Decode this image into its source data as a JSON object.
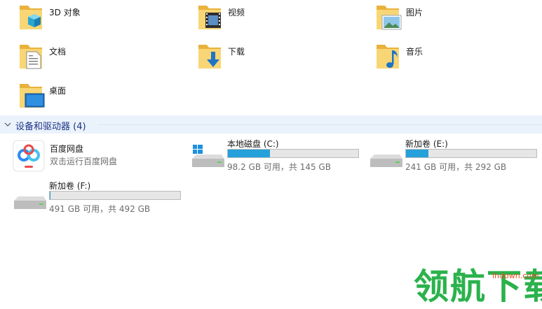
{
  "folders": [
    {
      "label": "3D 对象",
      "icon": "3d-objects-icon"
    },
    {
      "label": "视频",
      "icon": "videos-icon"
    },
    {
      "label": "图片",
      "icon": "pictures-icon"
    },
    {
      "label": "文档",
      "icon": "documents-icon"
    },
    {
      "label": "下载",
      "icon": "downloads-icon"
    },
    {
      "label": "音乐",
      "icon": "music-icon"
    },
    {
      "label": "桌面",
      "icon": "desktop-icon"
    }
  ],
  "devices_section": {
    "title": "设备和驱动器 (4)"
  },
  "app": {
    "name": "百度网盘",
    "description": "双击运行百度网盘",
    "icon": "baidu-netdisk-icon"
  },
  "drives": [
    {
      "label": "本地磁盘 (C:)",
      "size_text": "98.2 GB 可用，共 145 GB",
      "used_fraction": 0.32,
      "icon": "windows-drive-icon"
    },
    {
      "label": "新加卷 (E:)",
      "size_text": "241 GB 可用，共 292 GB",
      "used_fraction": 0.17,
      "icon": "hard-drive-icon"
    },
    {
      "label": "新加卷 (F:)",
      "size_text": "491 GB 可用，共 492 GB",
      "used_fraction": 0.002,
      "icon": "hard-drive-icon"
    }
  ],
  "watermark": {
    "text": "领航下载",
    "url": "lhdown.com"
  },
  "colors": {
    "accent": "#26a0da",
    "section_bg": "#eaf3fb",
    "section_text": "#1e3287",
    "folder": "#f4c65a"
  }
}
